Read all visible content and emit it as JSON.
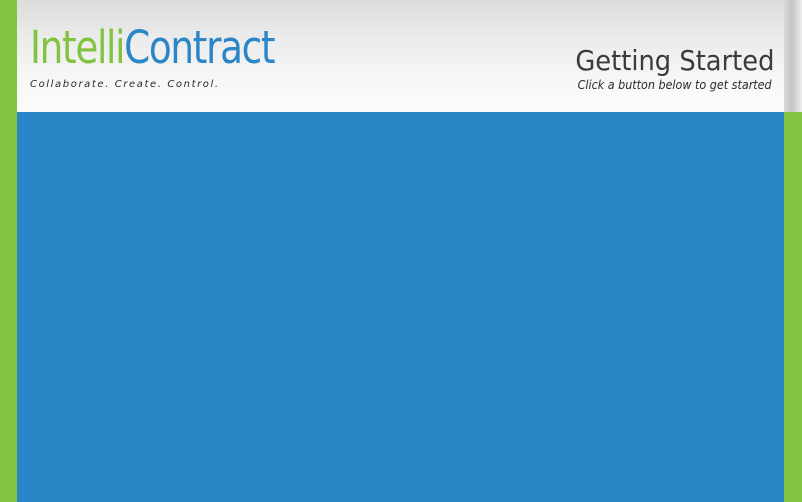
{
  "brand": {
    "name_part1": "Intelli",
    "name_part2": "Contract",
    "tagline": "Collaborate. Create. Control."
  },
  "header": {
    "title": "Getting Started",
    "subtitle": "Click a button below to get started"
  },
  "colors": {
    "accent_green": "#82c341",
    "brand_blue": "#2a86c7",
    "content_blue": "#2a86c7",
    "title_gray": "#3b3b3b"
  }
}
